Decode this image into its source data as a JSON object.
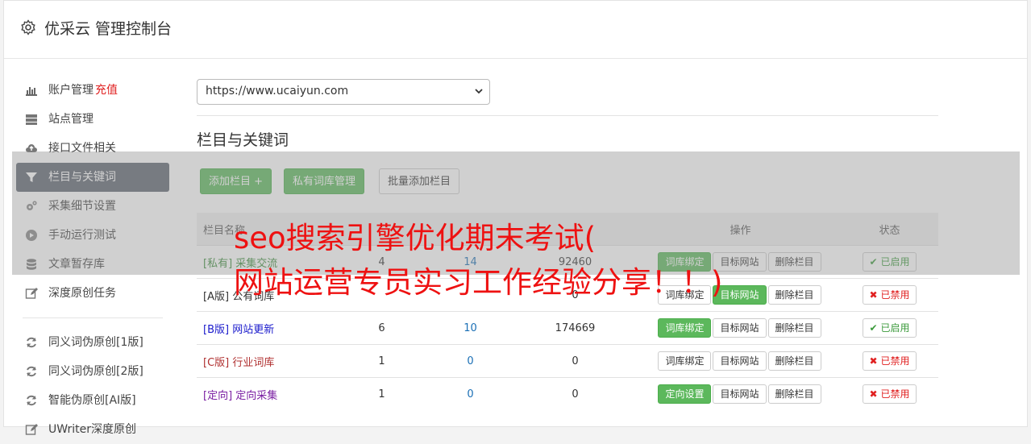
{
  "header": {
    "title": "优采云 管理控制台",
    "icon": "gear-icon"
  },
  "sidebar": {
    "items": [
      {
        "label": "账户管理",
        "accent": "充值",
        "icon": "bar-chart-icon"
      },
      {
        "label": "站点管理",
        "icon": "server-icon"
      },
      {
        "label": "接口文件相关",
        "icon": "cloud-upload-icon"
      },
      {
        "label": "栏目与关键词",
        "icon": "filter-icon",
        "active": true
      },
      {
        "label": "采集细节设置",
        "icon": "gears-icon"
      },
      {
        "label": "手动运行测试",
        "icon": "play-circle-icon"
      },
      {
        "label": "文章暂存库",
        "icon": "database-icon"
      },
      {
        "label": "深度原创任务",
        "icon": "edit-icon"
      }
    ],
    "items2": [
      {
        "label": "同义词伪原创[1版]",
        "icon": "refresh-icon"
      },
      {
        "label": "同义词伪原创[2版]",
        "icon": "refresh-icon"
      },
      {
        "label": "智能伪原创[AI版]",
        "icon": "refresh-icon"
      },
      {
        "label": "UWriter深度原创",
        "icon": "edit-icon"
      }
    ]
  },
  "main": {
    "site_select": "https://www.ucaiyun.com",
    "section_title": "栏目与关键词",
    "buttons": {
      "add": "添加栏目 +",
      "private": "私有词库管理",
      "batch": "批量添加栏目"
    },
    "table": {
      "headers": {
        "name": "栏目名称",
        "col2": "",
        "col3": "",
        "col4": "",
        "ops": "操作",
        "status": "状态"
      },
      "rows": [
        {
          "tag": "[私有]",
          "name": "采集交流",
          "a": "4",
          "b": "14",
          "c": "92460",
          "op1": "词库绑定",
          "op2": "目标网站",
          "op3": "删除栏目",
          "status": "已启用",
          "color": "#3c8d3c",
          "op1_green": true,
          "on": true
        },
        {
          "tag": "[A版]",
          "name": "公有词库",
          "a": "",
          "b": "",
          "c": "0",
          "op1": "词库绑定",
          "op2": "目标网站",
          "op3": "删除栏目",
          "status": "已禁用",
          "color": "#333333",
          "op2_green": true,
          "on": false
        },
        {
          "tag": "[B版]",
          "name": "网站更新",
          "a": "6",
          "b": "10",
          "c": "174669",
          "op1": "词库绑定",
          "op2": "目标网站",
          "op3": "删除栏目",
          "status": "已启用",
          "color": "#1a1acc",
          "op1_green": true,
          "on": true
        },
        {
          "tag": "[C版]",
          "name": "行业词库",
          "a": "1",
          "b": "0",
          "c": "0",
          "op1": "词库绑定",
          "op2": "目标网站",
          "op3": "删除栏目",
          "status": "已禁用",
          "color": "#b03030",
          "on": false
        },
        {
          "tag": "[定向]",
          "name": "定向采集",
          "a": "1",
          "b": "0",
          "c": "0",
          "op1": "定向设置",
          "op2": "目标网站",
          "op3": "删除栏目",
          "status": "已禁用",
          "color": "#7a1fa2",
          "op1_green": true,
          "on": false
        }
      ]
    }
  },
  "overlay": {
    "line1": "seo搜索引擎优化期末考试(",
    "line2": "网站运营专员实习工作经验分享！！)"
  },
  "colors": {
    "accent_green": "#5cb85c",
    "active_sidebar": "#5d6470",
    "overlay_text": "#ee1111"
  }
}
